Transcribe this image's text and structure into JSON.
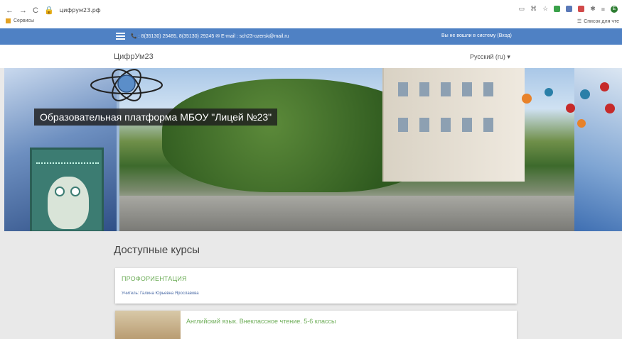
{
  "browser": {
    "url": "цифрум23.рф",
    "bookmark_label": "Сервисы",
    "reading_list_label": "Список для чте",
    "avatar_letter": "Е"
  },
  "topbar": {
    "contacts": "📞 : 8(35130) 25485, 8(35130) 29245 ✉ E-mail : sch23-ozersk@mail.ru",
    "login_text": "Вы не вошли в систему (Вход)"
  },
  "site": {
    "brand": "ЦифрУм23",
    "language": "Русский (ru) ▾"
  },
  "hero": {
    "title": "Образовательная платформа МБОУ \"Лицей №23\""
  },
  "courses": {
    "heading": "Доступные курсы",
    "items": [
      {
        "title": "ПРОФОРИЕНТАЦИЯ",
        "teacher": "Учитель: Галина Юрьевна Ярославова"
      },
      {
        "title": "Английский язык. Внеклассное чтение. 5-6 классы"
      }
    ]
  },
  "colors": {
    "topbar": "#4f81c4",
    "course_title": "#6fae5a"
  }
}
